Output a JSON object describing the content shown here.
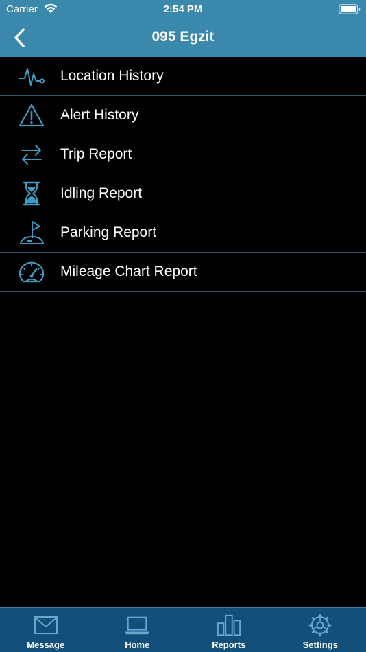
{
  "status_bar": {
    "carrier": "Carrier",
    "time": "2:54 PM"
  },
  "nav": {
    "title": "095 Egzit",
    "back_icon": "chevron-left-icon"
  },
  "menu": {
    "items": [
      {
        "label": "Location History",
        "icon": "pulse-line-icon"
      },
      {
        "label": "Alert History",
        "icon": "warning-triangle-icon"
      },
      {
        "label": "Trip Report",
        "icon": "swap-arrows-icon"
      },
      {
        "label": "Idling Report",
        "icon": "hourglass-icon"
      },
      {
        "label": "Parking Report",
        "icon": "golf-flag-icon"
      },
      {
        "label": "Mileage Chart Report",
        "icon": "speedometer-icon"
      }
    ]
  },
  "tabs": {
    "items": [
      {
        "label": "Message",
        "icon": "envelope-icon"
      },
      {
        "label": "Home",
        "icon": "laptop-icon"
      },
      {
        "label": "Reports",
        "icon": "bar-chart-icon"
      },
      {
        "label": "Settings",
        "icon": "gear-icon"
      }
    ]
  },
  "colors": {
    "header": "#3a88ac",
    "accent": "#3d9bc4",
    "tab_bar": "#124f7a",
    "background": "#000000",
    "divider": "#2f5b72"
  }
}
